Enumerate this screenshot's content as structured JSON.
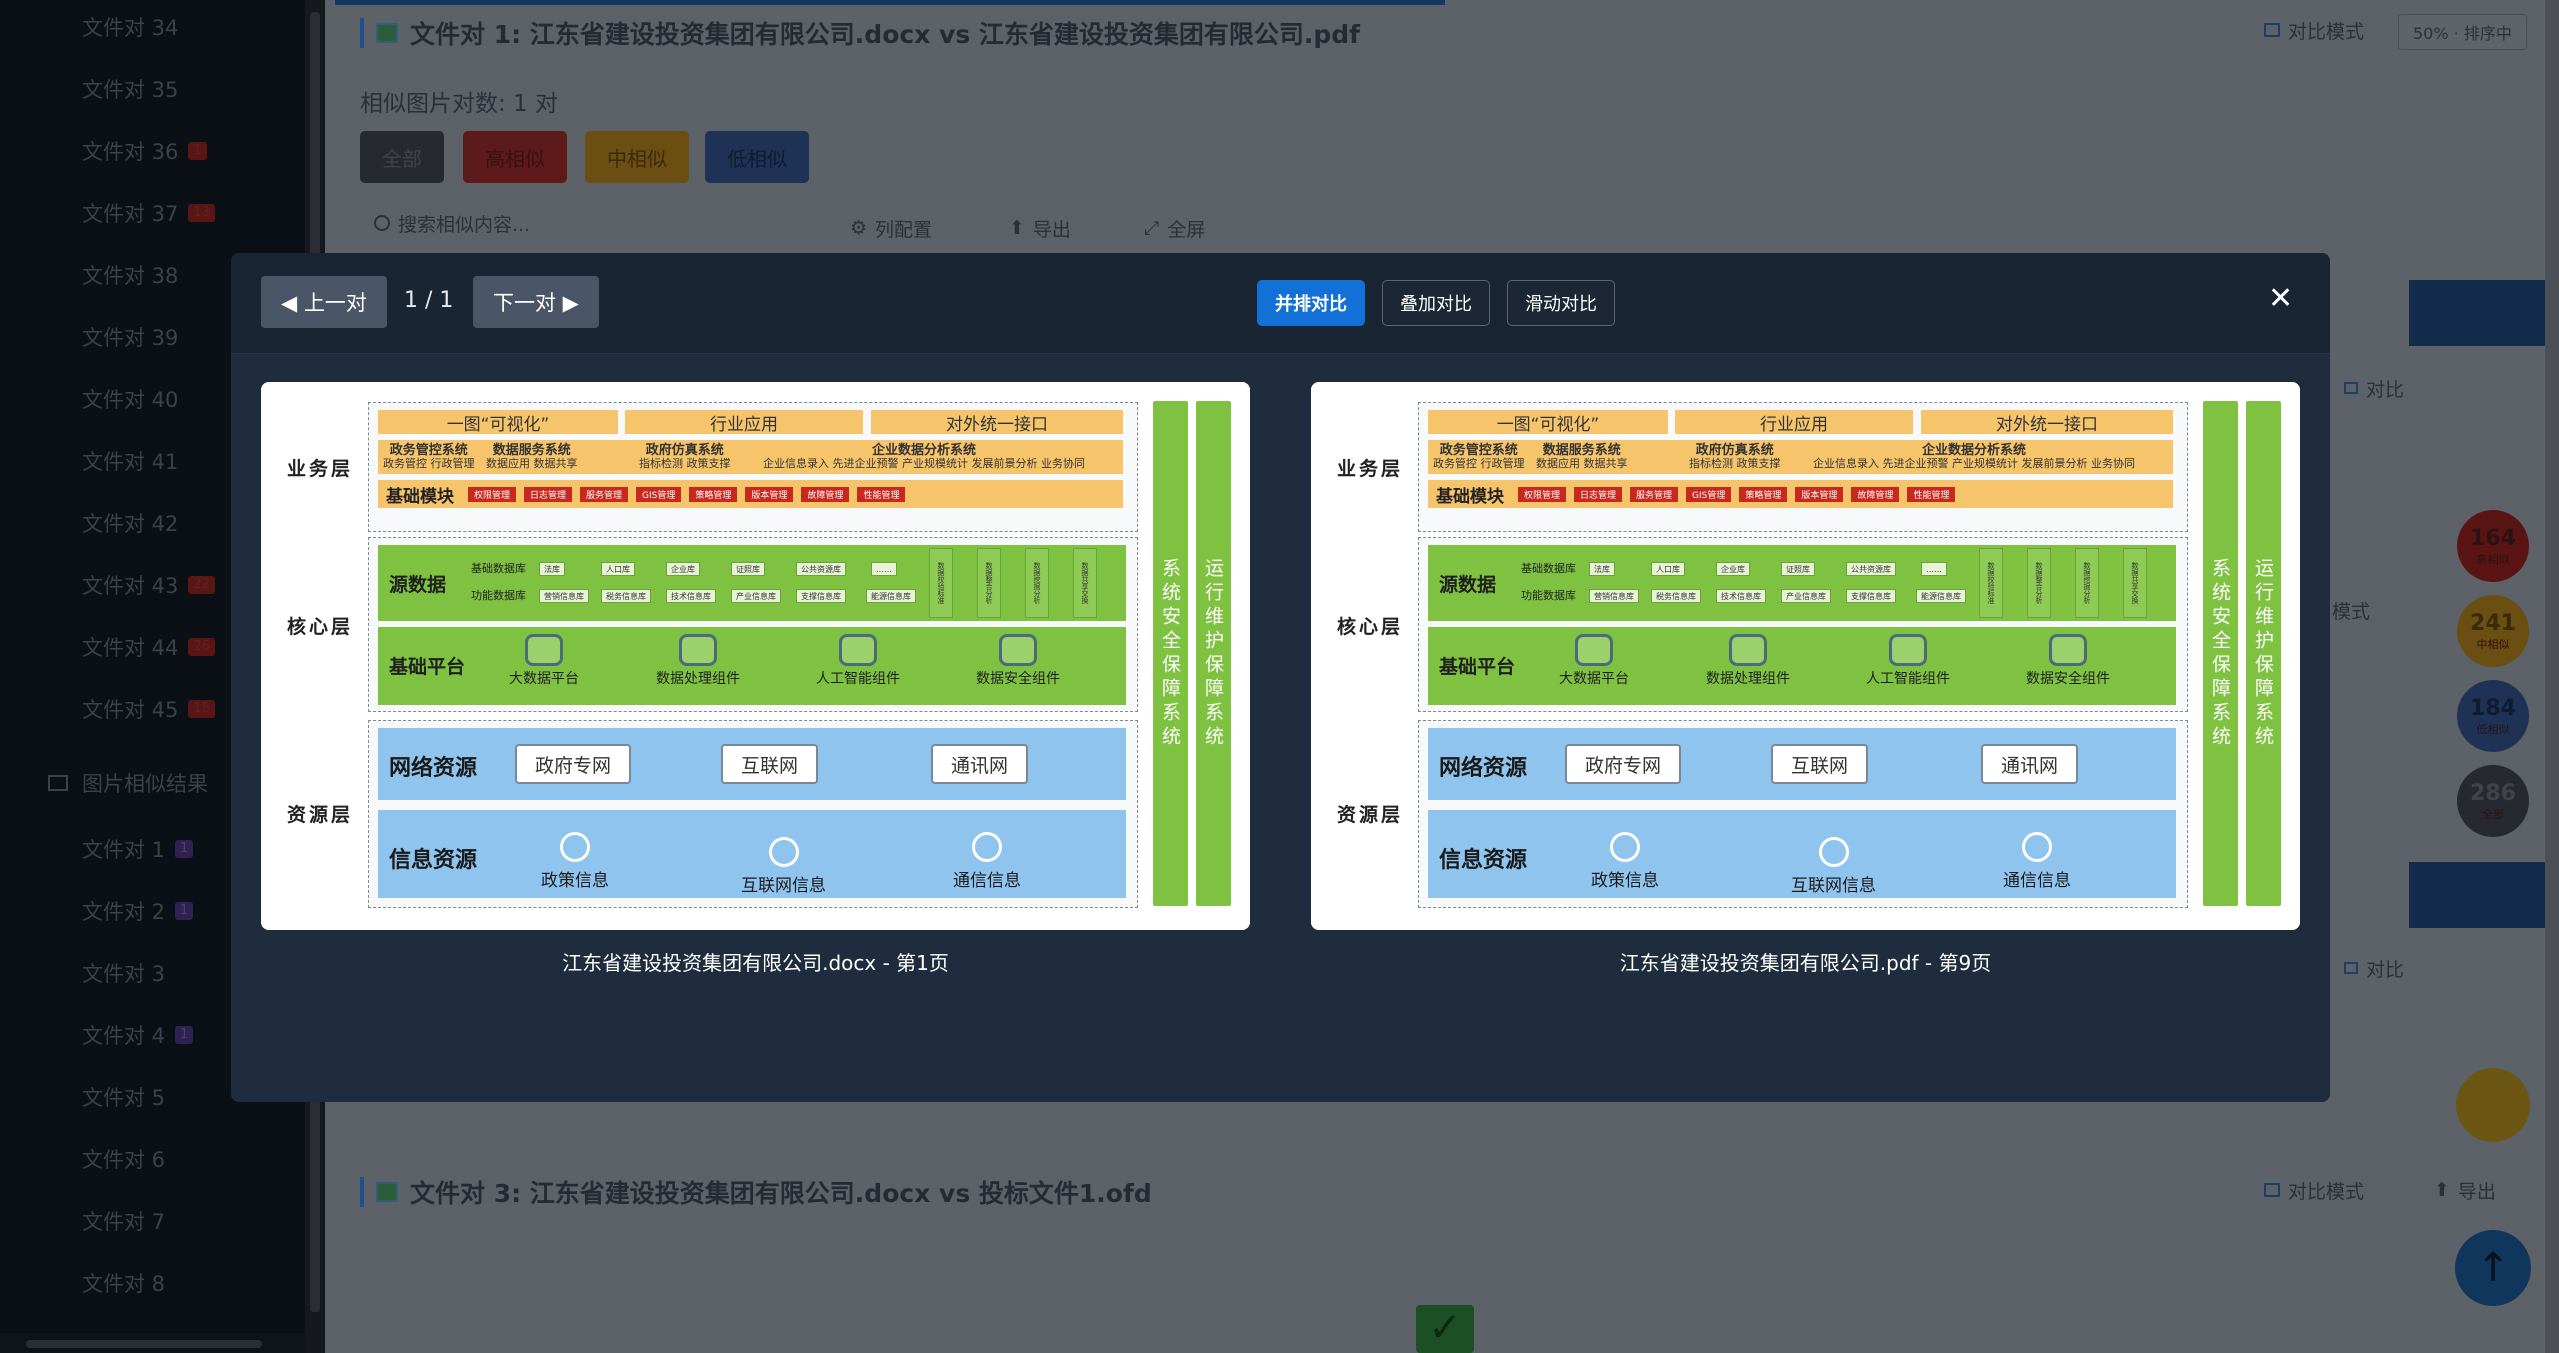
{
  "sidebar": {
    "items": [
      {
        "label": "文件对 34",
        "badge": ""
      },
      {
        "label": "文件对 35",
        "badge": ""
      },
      {
        "label": "文件对 36",
        "badge": "1"
      },
      {
        "label": "文件对 37",
        "badge": "13"
      },
      {
        "label": "文件对 38",
        "badge": ""
      },
      {
        "label": "文件对 39",
        "badge": ""
      },
      {
        "label": "文件对 40",
        "badge": ""
      },
      {
        "label": "文件对 41",
        "badge": ""
      },
      {
        "label": "文件对 42",
        "badge": ""
      },
      {
        "label": "文件对 43",
        "badge": "22"
      },
      {
        "label": "文件对 44",
        "badge": "26"
      },
      {
        "label": "文件对 45",
        "badge": "15"
      }
    ],
    "section_title": "图片相似结果",
    "image_items": [
      {
        "label": "文件对 1",
        "badge": "1"
      },
      {
        "label": "文件对 2",
        "badge": "1"
      },
      {
        "label": "文件对 3",
        "badge": ""
      },
      {
        "label": "文件对 4",
        "badge": "1"
      },
      {
        "label": "文件对 5",
        "badge": ""
      },
      {
        "label": "文件对 6",
        "badge": ""
      },
      {
        "label": "文件对 7",
        "badge": ""
      },
      {
        "label": "文件对 8",
        "badge": ""
      }
    ]
  },
  "background": {
    "pair1_title": "文件对 1: 江东省建设投资集团有限公司.docx vs 江东省建设投资集团有限公司.pdf",
    "pair1_compare_mode": "对比模式",
    "pair1_progress": "50% · 排序中",
    "similar_count": "相似图片对数: 1 对",
    "filters": [
      "全部",
      "高相似",
      "中相似",
      "低相似"
    ],
    "search_placeholder": "搜索相似内容...",
    "col_config": "列配置",
    "export": "导出",
    "fullscreen": "全屏",
    "compare": "对比",
    "mode": "模式",
    "circles": [
      {
        "value": "164",
        "label": "高相似"
      },
      {
        "value": "241",
        "label": "中相似"
      },
      {
        "value": "184",
        "label": "低相似"
      },
      {
        "value": "286",
        "label": "全部"
      }
    ],
    "pair3_title": "文件对 3: 江东省建设投资集团有限公司.docx vs 投标文件1.ofd",
    "pair3_compare_mode": "对比模式",
    "pair3_export": "导出"
  },
  "modal": {
    "prev": "◀ 上一对",
    "next": "下一对 ▶",
    "counter": "1 / 1",
    "modes": [
      "并排对比",
      "叠加对比",
      "滑动对比"
    ],
    "close": "✕",
    "left_caption": "江东省建设投资集团有限公司.docx - 第1页",
    "right_caption": "江东省建设投资集团有限公司.pdf - 第9页"
  },
  "diagram": {
    "layers": [
      "业务层",
      "核心层",
      "资源层"
    ],
    "top_tabs": [
      "一图“可视化”",
      "行业应用",
      "对外统一接口"
    ],
    "systems": [
      {
        "title": "政务管控系统",
        "sub": "政务管控  行政管理"
      },
      {
        "title": "数据服务系统",
        "sub": "数据应用 数据共享"
      },
      {
        "title": "政府仿真系统",
        "sub": "指标检测 政策支撑"
      },
      {
        "title": "企业数据分析系统",
        "sub": "企业信息录入  先进企业预警  产业规模统计  发展前景分析  业务协同"
      }
    ],
    "base_module": "基础模块",
    "modules": [
      "权限管理",
      "日志管理",
      "服务管理",
      "GIS管理",
      "策略管理",
      "版本管理",
      "故障管理",
      "性能管理"
    ],
    "source_data": "源数据",
    "base_db": "基础数据库",
    "func_db": "功能数据库",
    "db_chips": [
      "法库",
      "人口库",
      "企业库",
      "证照库",
      "公共资源库",
      "……"
    ],
    "func_chips": [
      "营销信息库",
      "税务信息库",
      "技术信息库",
      "产业信息库",
      "支撑信息库",
      "能源信息库"
    ],
    "v_chips": [
      "数据校验标准",
      "数据整合分析",
      "数据挖掘分析",
      "数据共享交换"
    ],
    "base_platform": "基础平台",
    "platforms": [
      "大数据平台",
      "数据处理组件",
      "人工智能组件",
      "数据安全组件"
    ],
    "network_res": "网络资源",
    "networks": [
      "政府专网",
      "互联网",
      "通讯网"
    ],
    "info_res": "信息资源",
    "infos": [
      "政策信息",
      "互联网信息",
      "通信信息"
    ],
    "vbar1": "系统安全保障系统",
    "vbar2": "运行维护保障系统"
  }
}
